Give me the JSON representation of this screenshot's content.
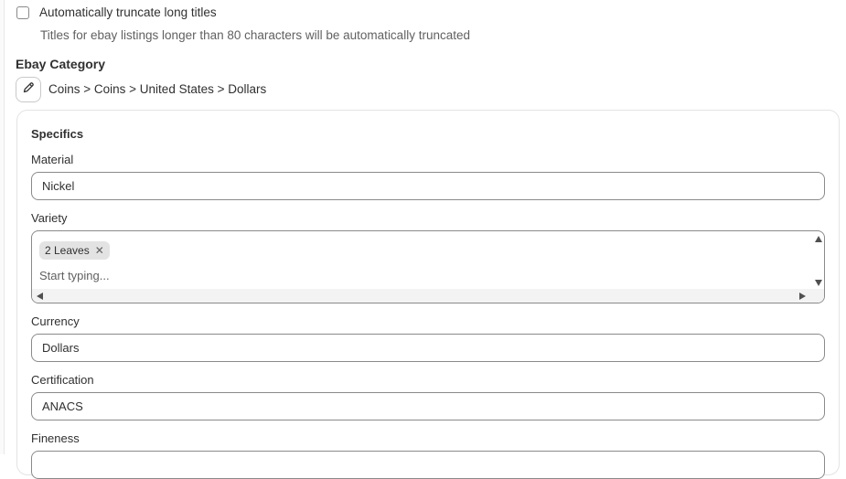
{
  "truncate": {
    "checkbox_label": "Automatically truncate long titles",
    "help_text": "Titles for ebay listings longer than 80 characters will be automatically truncated",
    "checked": false
  },
  "category": {
    "title": "Ebay Category",
    "path": "Coins > Coins > United States > Dollars"
  },
  "specifics": {
    "title": "Specifics",
    "material": {
      "label": "Material",
      "value": "Nickel"
    },
    "variety": {
      "label": "Variety",
      "tags": [
        "2 Leaves"
      ],
      "placeholder": "Start typing..."
    },
    "currency": {
      "label": "Currency",
      "value": "Dollars"
    },
    "certification": {
      "label": "Certification",
      "value": "ANACS"
    },
    "fineness": {
      "label": "Fineness",
      "value": ""
    }
  },
  "icons": {
    "edit": "pencil-icon",
    "remove_tag": "close-icon"
  }
}
